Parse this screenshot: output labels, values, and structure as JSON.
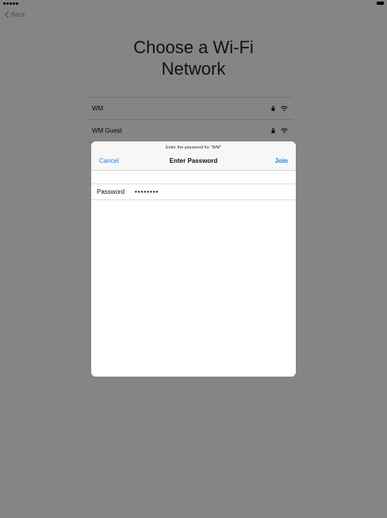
{
  "back_label": "Back",
  "page_title": "Choose a Wi-Fi\nNetwork",
  "networks": [
    {
      "name": "WM",
      "secured": true
    },
    {
      "name": "WM Guest",
      "secured": true
    }
  ],
  "dialog": {
    "prompt": "Enter the password for “WM”",
    "title": "Enter Password",
    "cancel_label": "Cancel",
    "join_label": "Join",
    "password_label": "Password",
    "password_value": "••••••••"
  },
  "colors": {
    "accent": "#1a7fe0",
    "dim_overlay": "rgba(0,0,0,0.48)"
  },
  "icons": [
    "chevron-left-icon",
    "lock-icon",
    "wifi-icon",
    "battery-icon",
    "signal-icon"
  ]
}
